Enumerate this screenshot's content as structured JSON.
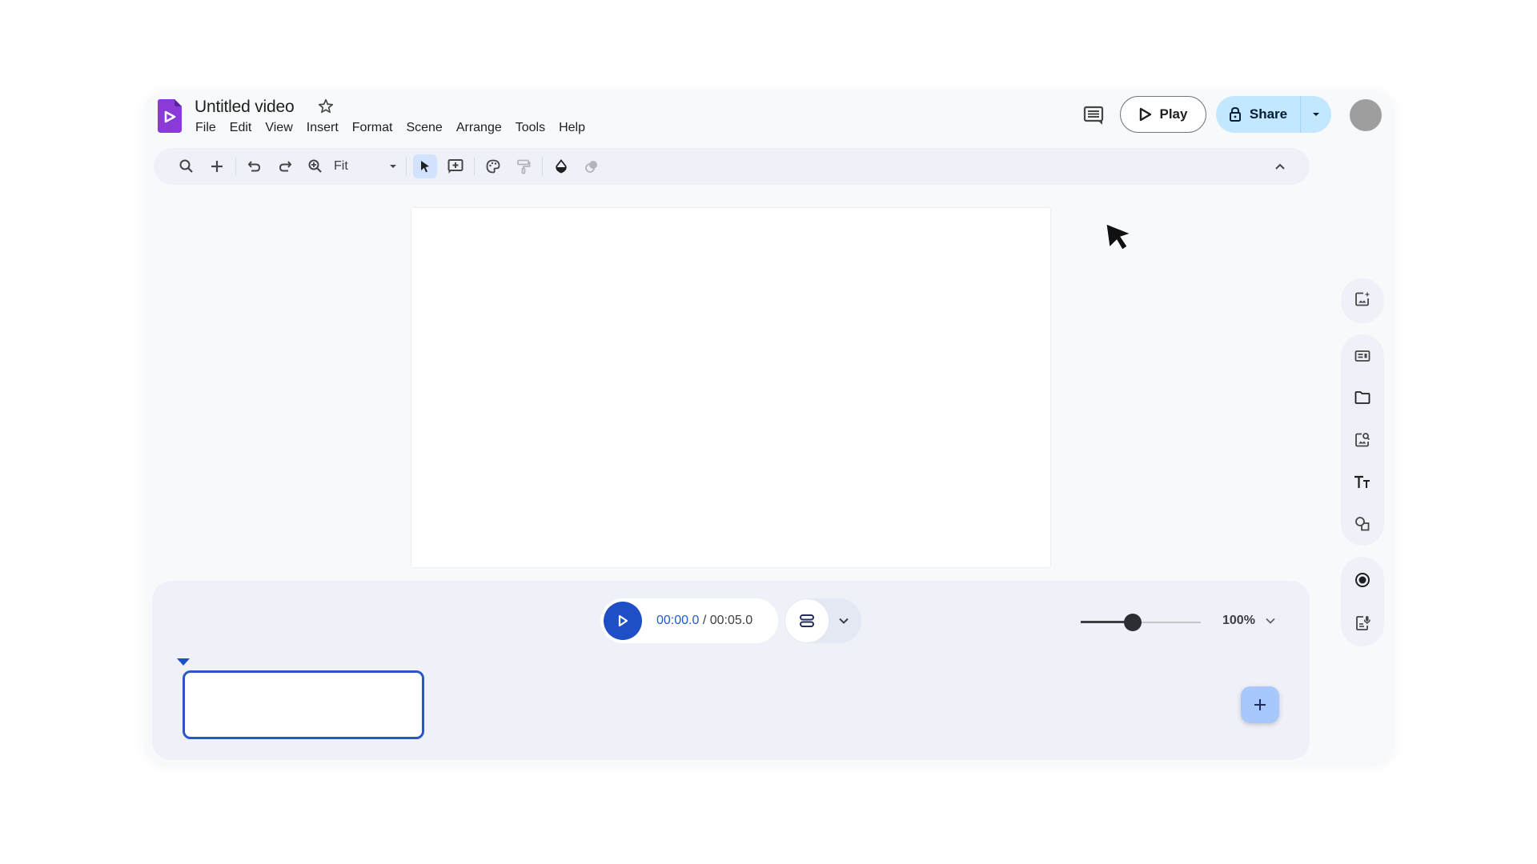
{
  "app": {
    "title": "Untitled video",
    "menu": [
      "File",
      "Edit",
      "View",
      "Insert",
      "Format",
      "Scene",
      "Arrange",
      "Tools",
      "Help"
    ],
    "brand_color": "#8430ce"
  },
  "header": {
    "play_label": "Play",
    "share_label": "Share"
  },
  "toolbar": {
    "zoom_value": "Fit",
    "icons": [
      "search-icon",
      "add-icon",
      "undo-icon",
      "redo-icon",
      "zoom-icon",
      "select-icon",
      "add-comment-box-icon",
      "palette-icon",
      "paint-roller-icon",
      "fill-color-icon",
      "effects-icon"
    ],
    "active_tool": "select"
  },
  "right_rail": {
    "group1": [
      "add-image-ai-icon"
    ],
    "group2": [
      "templates-icon",
      "folder-icon",
      "image-search-icon",
      "text-icon",
      "shapes-icon"
    ],
    "group3": [
      "record-icon",
      "voiceover-script-icon"
    ]
  },
  "playback": {
    "current_time": "00:00.0",
    "separator": " / ",
    "total_time": "00:05.0",
    "zoom_percent_label": "100%",
    "zoom_slider_fraction": 0.43
  },
  "timeline": {
    "scenes": 1,
    "accent_color": "#1f4fc7"
  }
}
